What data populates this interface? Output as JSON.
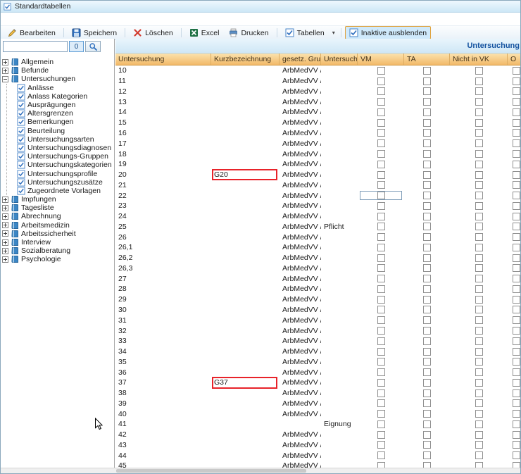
{
  "window": {
    "title": "Standardtabellen"
  },
  "colors": {
    "annotation_red": "#e8232a",
    "header_orange": "#f2b969",
    "panel_blue": "#1553a0",
    "highlight_border": "#e0a23c"
  },
  "toolbar": {
    "buttons": [
      {
        "name": "edit-button",
        "label": "Bearbeiten",
        "icon": "pencil-icon",
        "sep_after": true
      },
      {
        "name": "save-button",
        "label": "Speichern",
        "icon": "save-icon",
        "sep_after": true
      },
      {
        "name": "delete-button",
        "label": "Löschen",
        "icon": "delete-icon",
        "sep_after": true
      },
      {
        "name": "excel-button",
        "label": "Excel",
        "icon": "excel-icon"
      },
      {
        "name": "print-button",
        "label": "Drucken",
        "icon": "printer-icon",
        "sep_after": true
      },
      {
        "name": "tables-button",
        "label": "Tabellen",
        "icon": "table-check-icon",
        "dropdown": true,
        "sep_after": true
      },
      {
        "name": "hide-inactive-toggle",
        "label": "Inaktive ausblenden",
        "icon": "check-icon",
        "highlighted": true
      }
    ]
  },
  "sidebar": {
    "search": {
      "value": "",
      "counter": "0"
    },
    "tree": [
      {
        "label": "Allgemein",
        "expanded": false
      },
      {
        "label": "Befunde",
        "expanded": false
      },
      {
        "label": "Untersuchungen",
        "expanded": true,
        "children": [
          "Anlässe",
          "Anlass Kategorien",
          "Ausprägungen",
          "Altersgrenzen",
          "Bemerkungen",
          "Beurteilung",
          "Untersuchungsarten",
          "Untersuchungsdiagnosen",
          "Untersuchungs-Gruppen",
          "Untersuchungskategorien",
          "Untersuchungsprofile",
          "Untersuchungszusätze",
          "Zugeordnete Vorlagen"
        ]
      },
      {
        "label": "Impfungen",
        "expanded": false
      },
      {
        "label": "Tagesliste",
        "expanded": false
      },
      {
        "label": "Abrechnung",
        "expanded": false
      },
      {
        "label": "Arbeitsmedizin",
        "expanded": false
      },
      {
        "label": "Arbeitssicherheit",
        "expanded": false
      },
      {
        "label": "Interview",
        "expanded": false
      },
      {
        "label": "Sozialberatung",
        "expanded": false
      },
      {
        "label": "Psychologie",
        "expanded": false
      }
    ]
  },
  "main": {
    "panel_title": "Untersuchung",
    "table": {
      "columns": [
        {
          "label": "Untersuchung",
          "key": "nr"
        },
        {
          "label": "Kurzbezeichnung",
          "key": "kurz"
        },
        {
          "label": "gesetz. Gru",
          "key": "gesetz"
        },
        {
          "label": "Untersuchu",
          "key": "art"
        },
        {
          "label": "VM",
          "key": "vm",
          "checkbox": true
        },
        {
          "label": "TA",
          "key": "ta",
          "checkbox": true
        },
        {
          "label": "Nicht in VK",
          "key": "nvk",
          "checkbox": true
        },
        {
          "label": "O",
          "key": "o",
          "checkbox": true
        }
      ],
      "rows": [
        {
          "nr": "10",
          "gesetz": "ArbMedVV /"
        },
        {
          "nr": "11",
          "gesetz": "ArbMedVV /"
        },
        {
          "nr": "12",
          "gesetz": "ArbMedVV /"
        },
        {
          "nr": "13",
          "gesetz": "ArbMedVV /"
        },
        {
          "nr": "14",
          "gesetz": "ArbMedVV /"
        },
        {
          "nr": "15",
          "gesetz": "ArbMedVV /"
        },
        {
          "nr": "16",
          "gesetz": "ArbMedVV /"
        },
        {
          "nr": "17",
          "gesetz": "ArbMedVV /"
        },
        {
          "nr": "18",
          "gesetz": "ArbMedVV /"
        },
        {
          "nr": "19",
          "gesetz": "ArbMedVV /"
        },
        {
          "nr": "20",
          "kurz": "G20",
          "gesetz": "ArbMedVV /",
          "marked": true
        },
        {
          "nr": "21",
          "gesetz": "ArbMedVV /"
        },
        {
          "nr": "22",
          "gesetz": "ArbMedVV /",
          "vm_editor": true
        },
        {
          "nr": "23",
          "gesetz": "ArbMedVV /"
        },
        {
          "nr": "24",
          "gesetz": "ArbMedVV /"
        },
        {
          "nr": "25",
          "gesetz": "ArbMedVV /",
          "art": "Pflicht"
        },
        {
          "nr": "26",
          "gesetz": "ArbMedVV /"
        },
        {
          "nr": "26,1",
          "gesetz": "ArbMedVV /"
        },
        {
          "nr": "26,2",
          "gesetz": "ArbMedVV /"
        },
        {
          "nr": "26,3",
          "gesetz": "ArbMedVV /"
        },
        {
          "nr": "27",
          "gesetz": "ArbMedVV /"
        },
        {
          "nr": "28",
          "gesetz": "ArbMedVV /"
        },
        {
          "nr": "29",
          "gesetz": "ArbMedVV /"
        },
        {
          "nr": "30",
          "gesetz": "ArbMedVV /"
        },
        {
          "nr": "31",
          "gesetz": "ArbMedVV /"
        },
        {
          "nr": "32",
          "gesetz": "ArbMedVV /"
        },
        {
          "nr": "33",
          "gesetz": "ArbMedVV /"
        },
        {
          "nr": "34",
          "gesetz": "ArbMedVV /"
        },
        {
          "nr": "35",
          "gesetz": "ArbMedVV /"
        },
        {
          "nr": "36",
          "gesetz": "ArbMedVV /"
        },
        {
          "nr": "37",
          "kurz": "G37",
          "gesetz": "ArbMedVV /",
          "marked": true
        },
        {
          "nr": "38",
          "gesetz": "ArbMedVV /"
        },
        {
          "nr": "39",
          "gesetz": "ArbMedVV /"
        },
        {
          "nr": "40",
          "gesetz": "ArbMedVV /"
        },
        {
          "nr": "41",
          "art": "Eignung"
        },
        {
          "nr": "42",
          "gesetz": "ArbMedVV /"
        },
        {
          "nr": "43",
          "gesetz": "ArbMedVV /"
        },
        {
          "nr": "44",
          "gesetz": "ArbMedVV /"
        },
        {
          "nr": "45",
          "gesetz": "ArbMedVV /"
        }
      ]
    }
  }
}
